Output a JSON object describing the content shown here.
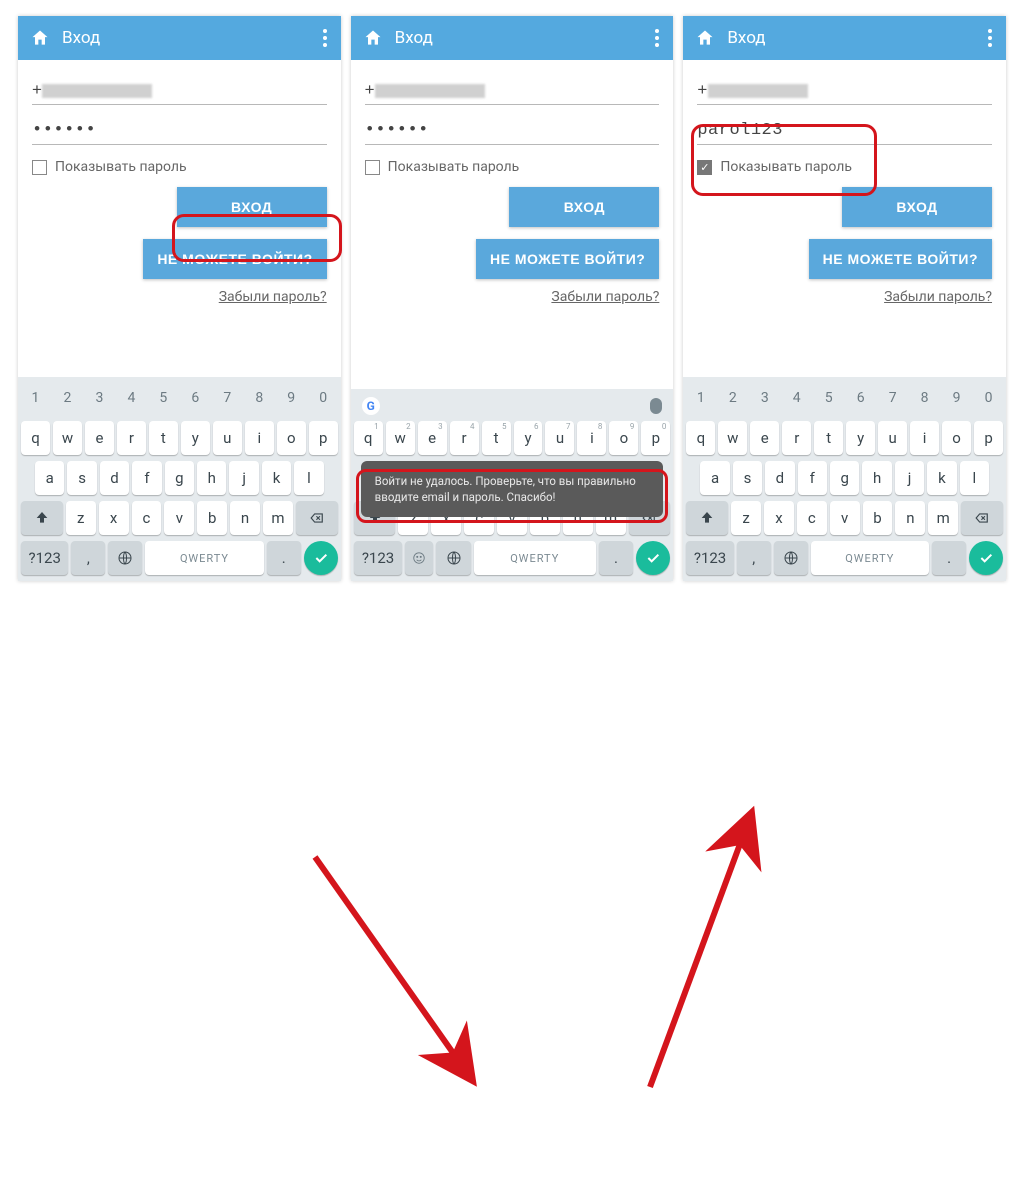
{
  "app": {
    "title": "Вход"
  },
  "common": {
    "showPasswordLabel": "Показывать пароль",
    "loginButton": "ВХОД",
    "cantLoginButton": "НЕ МОЖЕТЕ ВОЙТИ?",
    "forgotLink": "Забыли пароль?"
  },
  "screen1": {
    "phonePrefix": "+",
    "passwordMasked": "••••••"
  },
  "screen2": {
    "phonePrefix": "+",
    "passwordMasked": "••••••",
    "toast": "Войти не удалось. Проверьте, что вы правильно вводите email и пароль. Спасибо!"
  },
  "screen3": {
    "phonePrefix": "+",
    "passwordPlain": "parol123"
  },
  "keyboard": {
    "numbers": [
      "1",
      "2",
      "3",
      "4",
      "5",
      "6",
      "7",
      "8",
      "9",
      "0"
    ],
    "row1": [
      "q",
      "w",
      "e",
      "r",
      "t",
      "y",
      "u",
      "i",
      "o",
      "p"
    ],
    "row1sup": [
      "",
      "",
      "",
      "",
      "",
      "",
      "",
      "",
      "",
      ""
    ],
    "row2": [
      "a",
      "s",
      "d",
      "f",
      "g",
      "h",
      "j",
      "k",
      "l"
    ],
    "row3": [
      "z",
      "x",
      "c",
      "v",
      "b",
      "n",
      "m"
    ],
    "symKey": "?123",
    "comma": ",",
    "dot": ".",
    "spaceLabel": "QWERTY"
  }
}
